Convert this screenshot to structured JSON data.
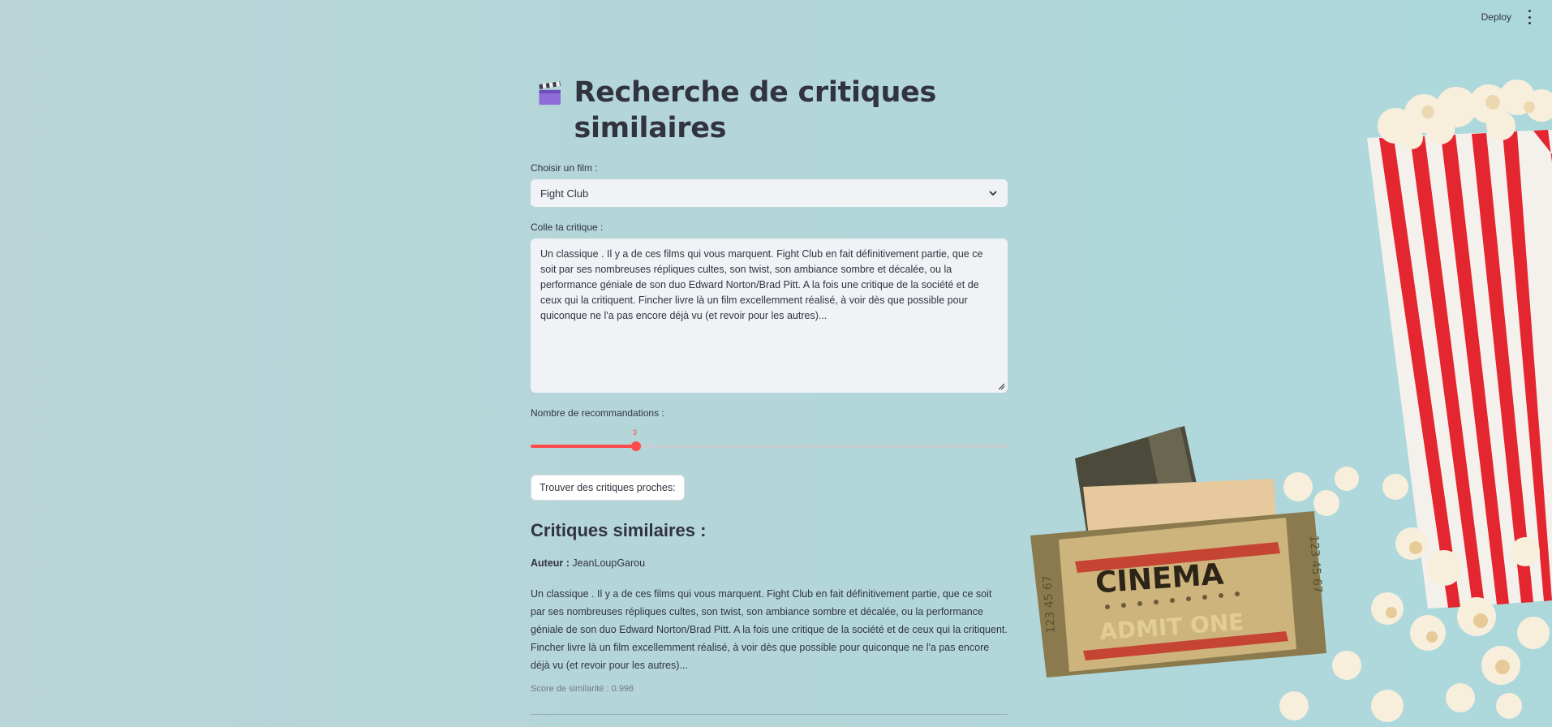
{
  "topbar": {
    "deploy_label": "Deploy"
  },
  "page": {
    "title": "Recherche de critiques similaires"
  },
  "film_select": {
    "label": "Choisir un film :",
    "value": "Fight Club"
  },
  "critique": {
    "label": "Colle ta critique :",
    "value": "Un classique . Il y a de ces films qui vous marquent. Fight Club en fait définitivement partie, que ce soit par ses nombreuses répliques cultes, son twist, son ambiance sombre et décalée, ou la performance géniale de son duo Edward Norton/Brad Pitt. A la fois une critique de la société et de ceux qui la critiquent. Fincher livre là un film excellemment réalisé, à voir dès que possible pour quiconque ne l'a pas encore déjà vu (et revoir pour les autres)..."
  },
  "recommendations": {
    "label": "Nombre de recommandations :",
    "value": "3"
  },
  "search_button": {
    "label": "Trouver des critiques proches:"
  },
  "results": {
    "heading": "Critiques similaires :",
    "items": [
      {
        "author_label": "Auteur :",
        "author": "JeanLoupGarou",
        "text": "Un classique . Il y a de ces films qui vous marquent. Fight Club en fait définitivement partie, que ce soit par ses nombreuses répliques cultes, son twist, son ambiance sombre et décalée, ou la performance géniale de son duo Edward Norton/Brad Pitt. A la fois une critique de la société et de ceux qui la critiquent. Fincher livre là un film excellemment réalisé, à voir dès que possible pour quiconque ne l'a pas encore déjà vu (et revoir pour les autres)...",
        "score": "Score de similarité : 0.998"
      }
    ]
  },
  "background": {
    "ticket_title": "CINEMA",
    "ticket_subtitle": "ADMIT ONE",
    "ticket_number": "123 45 67"
  },
  "colors": {
    "accent": "#ff4b4b",
    "input_bg": "#f0f2f6",
    "text": "#31333f"
  },
  "icons": [
    "clapperboard-icon",
    "chevron-down-icon",
    "kebab-menu-icon",
    "resize-handle-icon"
  ]
}
